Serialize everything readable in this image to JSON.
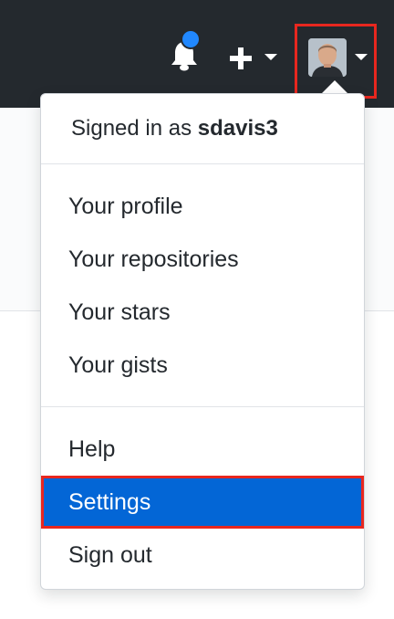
{
  "header": {
    "notification_icon": "bell-icon",
    "notification_badge_color": "#2188ff",
    "create_icon": "plus-icon",
    "avatar_icon": "user-avatar"
  },
  "dropdown": {
    "signed_in_prefix": "Signed in as",
    "username": "sdavis3",
    "items": [
      {
        "label": "Your profile"
      },
      {
        "label": "Your repositories"
      },
      {
        "label": "Your stars"
      },
      {
        "label": "Your gists"
      },
      {
        "label": "Help"
      },
      {
        "label": "Settings"
      },
      {
        "label": "Sign out"
      }
    ],
    "selected_label": "Settings"
  },
  "colors": {
    "header_bg": "#24292e",
    "selected_bg": "#0366d6",
    "highlight": "#e8271f"
  }
}
